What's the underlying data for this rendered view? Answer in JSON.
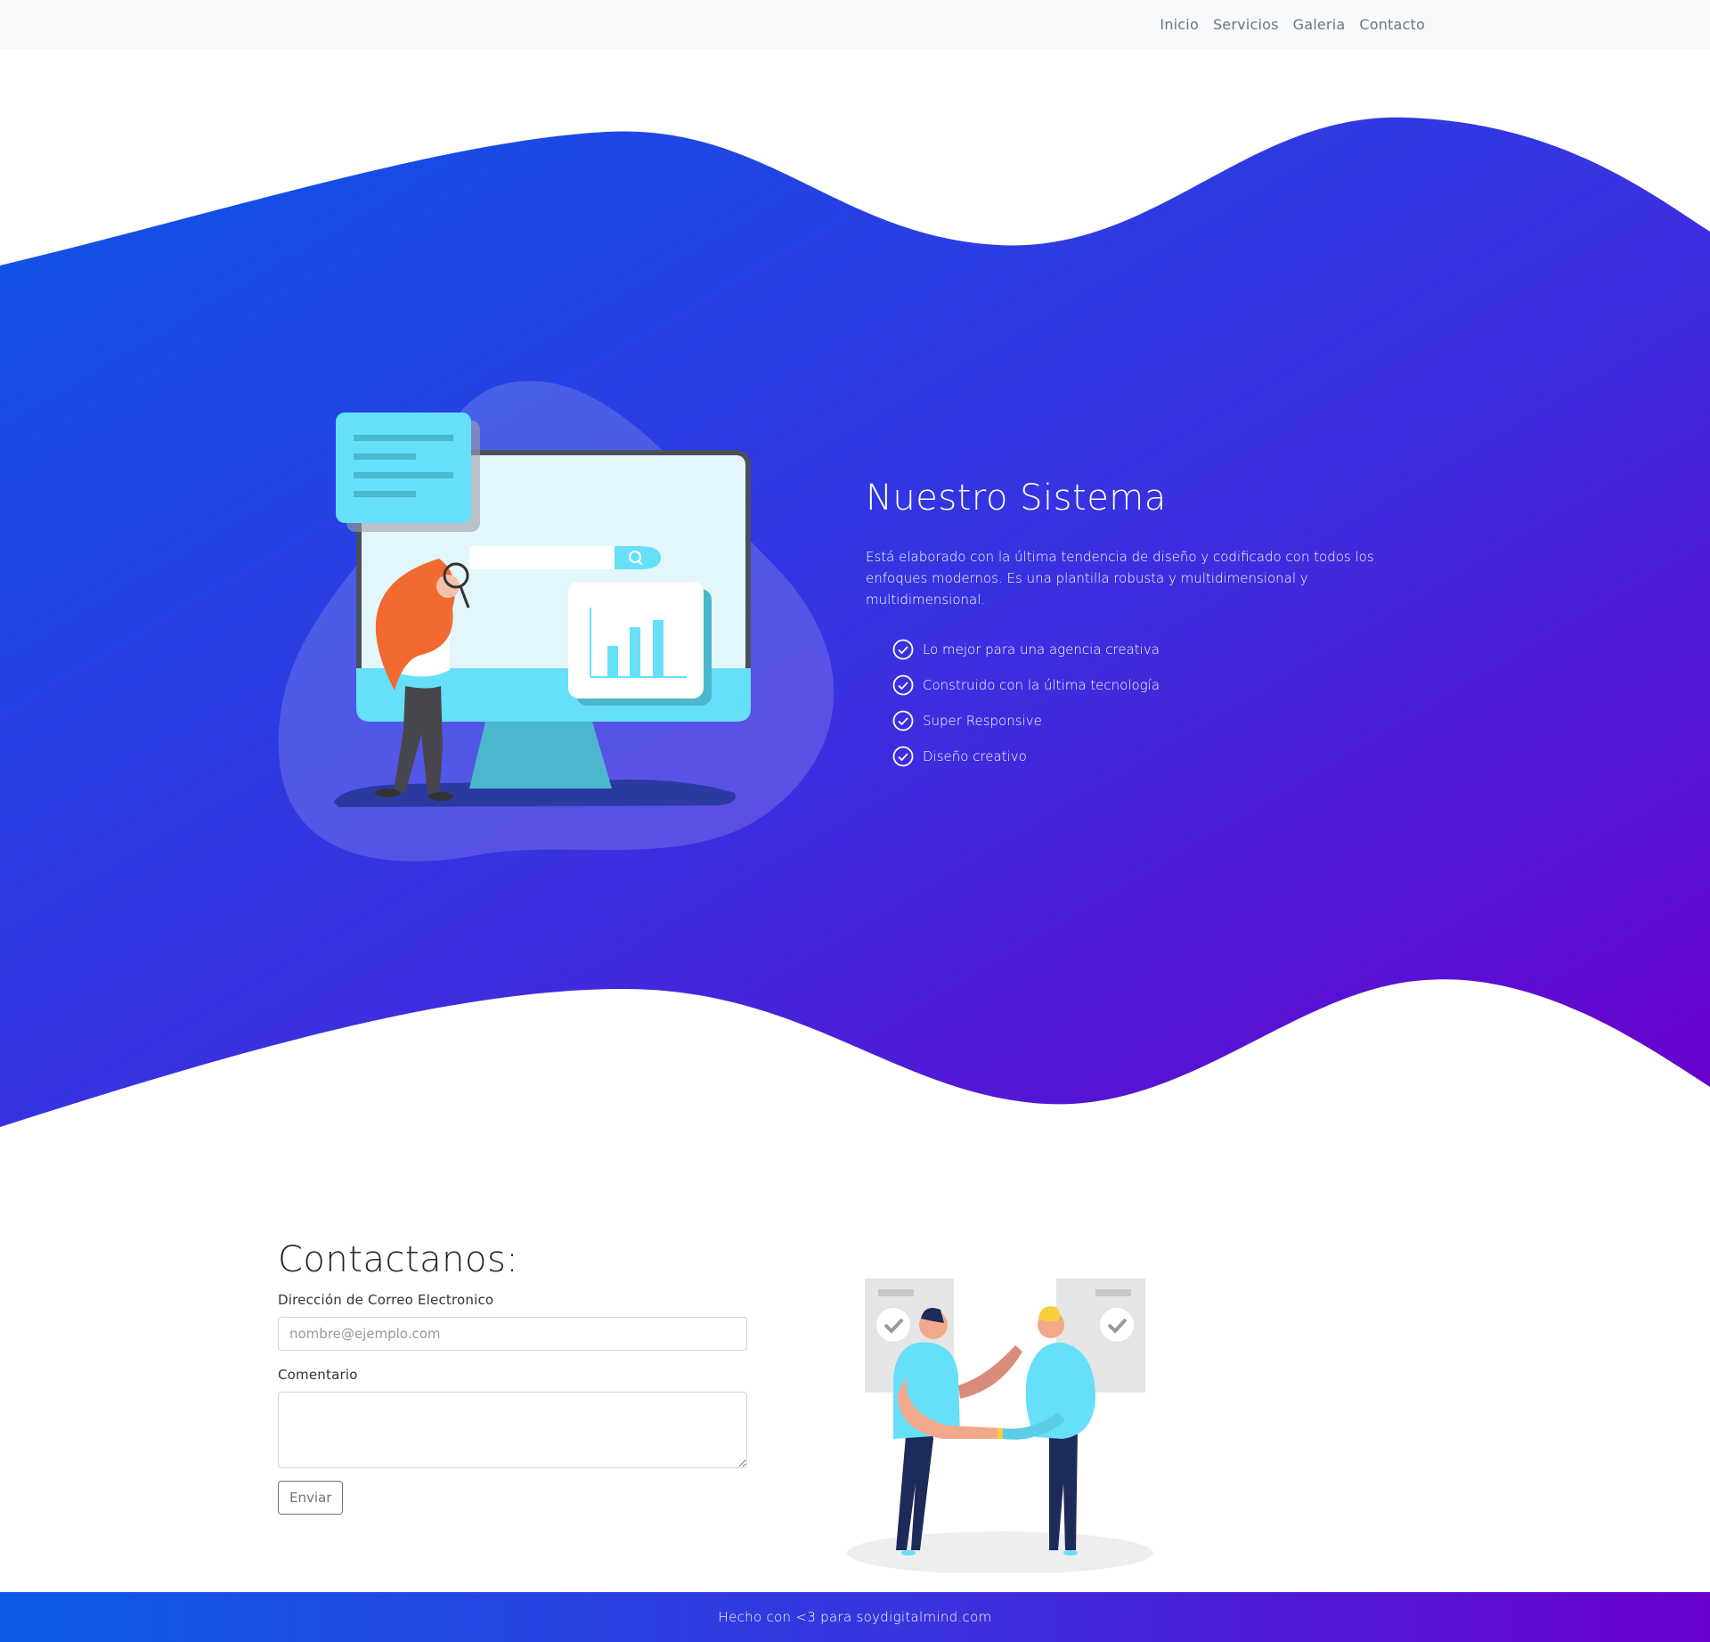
{
  "nav": {
    "links": [
      "Inicio",
      "Servicios",
      "Galeria",
      "Contacto"
    ]
  },
  "hero": {
    "title": "Nuestro Sistema",
    "description": "Está elaborado con la última tendencia de diseño y codificado con todos los enfoques modernos. Es una plantilla robusta y multidimensional y multidimensional.",
    "features": [
      "Lo mejor para una agencia creativa",
      "Construido con la última tecnología",
      "Super Responsive",
      "Diseño creativo"
    ],
    "gradient": [
      "#0c55e8",
      "#3b2fe0",
      "#6a00cc"
    ]
  },
  "contact": {
    "title": "Contactanos:",
    "email_label": "Dirección de Correo Electronico",
    "email_placeholder": "nombre@ejemplo.com",
    "comment_label": "Comentario",
    "submit_label": "Enviar"
  },
  "footer": {
    "text": "Hecho con <3 para soydigitalmind.com"
  },
  "icons": {
    "feature": "check-circle-icon"
  }
}
